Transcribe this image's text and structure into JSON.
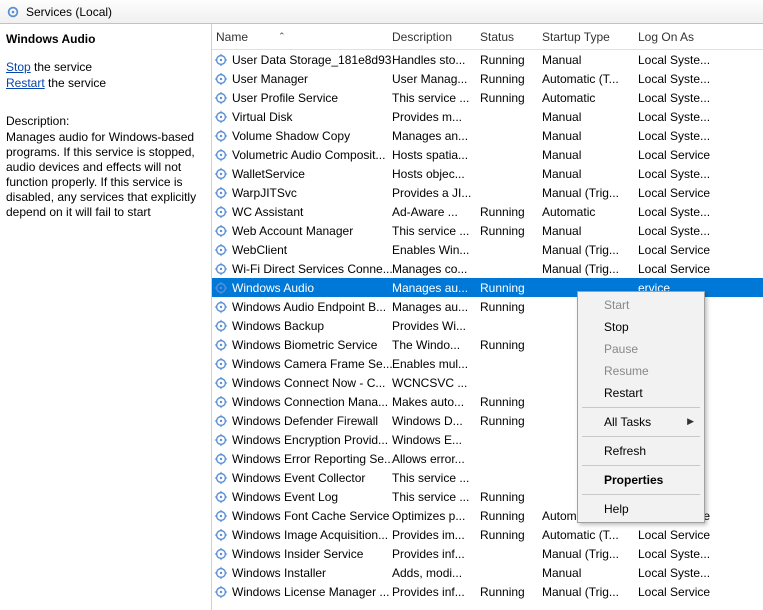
{
  "titlebar": {
    "label": "Services (Local)"
  },
  "left": {
    "service_title": "Windows Audio",
    "stop_label": "Stop",
    "stop_suffix": " the service",
    "restart_label": "Restart",
    "restart_suffix": " the service",
    "desc_head": "Description:",
    "desc_body": "Manages audio for Windows-based programs.  If this service is stopped, audio devices and effects will not function properly. If this service is disabled, any services that explicitly depend on it will fail to start"
  },
  "columns": {
    "name": "Name",
    "desc": "Description",
    "status": "Status",
    "startup": "Startup Type",
    "logon": "Log On As"
  },
  "rows": [
    {
      "name": "User Data Storage_181e8d93",
      "desc": "Handles sto...",
      "status": "Running",
      "startup": "Manual",
      "logon": "Local Syste..."
    },
    {
      "name": "User Manager",
      "desc": "User Manag...",
      "status": "Running",
      "startup": "Automatic (T...",
      "logon": "Local Syste..."
    },
    {
      "name": "User Profile Service",
      "desc": "This service ...",
      "status": "Running",
      "startup": "Automatic",
      "logon": "Local Syste..."
    },
    {
      "name": "Virtual Disk",
      "desc": "Provides m...",
      "status": "",
      "startup": "Manual",
      "logon": "Local Syste..."
    },
    {
      "name": "Volume Shadow Copy",
      "desc": "Manages an...",
      "status": "",
      "startup": "Manual",
      "logon": "Local Syste..."
    },
    {
      "name": "Volumetric Audio Composit...",
      "desc": "Hosts spatia...",
      "status": "",
      "startup": "Manual",
      "logon": "Local Service"
    },
    {
      "name": "WalletService",
      "desc": "Hosts objec...",
      "status": "",
      "startup": "Manual",
      "logon": "Local Syste..."
    },
    {
      "name": "WarpJITSvc",
      "desc": "Provides a JI...",
      "status": "",
      "startup": "Manual (Trig...",
      "logon": "Local Service"
    },
    {
      "name": "WC Assistant",
      "desc": "Ad-Aware ...",
      "status": "Running",
      "startup": "Automatic",
      "logon": "Local Syste..."
    },
    {
      "name": "Web Account Manager",
      "desc": "This service ...",
      "status": "Running",
      "startup": "Manual",
      "logon": "Local Syste..."
    },
    {
      "name": "WebClient",
      "desc": "Enables Win...",
      "status": "",
      "startup": "Manual (Trig...",
      "logon": "Local Service"
    },
    {
      "name": "Wi-Fi Direct Services Conne...",
      "desc": "Manages co...",
      "status": "",
      "startup": "Manual (Trig...",
      "logon": "Local Service"
    },
    {
      "name": "Windows Audio",
      "desc": "Manages au...",
      "status": "Running",
      "startup": "",
      "logon": "ervice",
      "selected": true
    },
    {
      "name": "Windows Audio Endpoint B...",
      "desc": "Manages au...",
      "status": "Running",
      "startup": "",
      "logon": "ste..."
    },
    {
      "name": "Windows Backup",
      "desc": "Provides Wi...",
      "status": "",
      "startup": "",
      "logon": "ste..."
    },
    {
      "name": "Windows Biometric Service",
      "desc": "The Windo...",
      "status": "Running",
      "startup": "",
      "logon": "ste..."
    },
    {
      "name": "Windows Camera Frame Se...",
      "desc": "Enables mul...",
      "status": "",
      "startup": "",
      "logon": "ervice"
    },
    {
      "name": "Windows Connect Now - C...",
      "desc": "WCNCSVC ...",
      "status": "",
      "startup": "",
      "logon": "ervice"
    },
    {
      "name": "Windows Connection Mana...",
      "desc": "Makes auto...",
      "status": "Running",
      "startup": "",
      "logon": "ste..."
    },
    {
      "name": "Windows Defender Firewall",
      "desc": "Windows D...",
      "status": "Running",
      "startup": "",
      "logon": "ervice"
    },
    {
      "name": "Windows Encryption Provid...",
      "desc": "Windows E...",
      "status": "",
      "startup": "",
      "logon": "ervice"
    },
    {
      "name": "Windows Error Reporting Se...",
      "desc": "Allows error...",
      "status": "",
      "startup": "",
      "logon": "ste..."
    },
    {
      "name": "Windows Event Collector",
      "desc": "This service ...",
      "status": "",
      "startup": "",
      "logon": "k S..."
    },
    {
      "name": "Windows Event Log",
      "desc": "This service ...",
      "status": "Running",
      "startup": "",
      "logon": "ervice"
    },
    {
      "name": "Windows Font Cache Service",
      "desc": "Optimizes p...",
      "status": "Running",
      "startup": "Automatic",
      "logon": "Local Service"
    },
    {
      "name": "Windows Image Acquisition...",
      "desc": "Provides im...",
      "status": "Running",
      "startup": "Automatic (T...",
      "logon": "Local Service"
    },
    {
      "name": "Windows Insider Service",
      "desc": "Provides inf...",
      "status": "",
      "startup": "Manual (Trig...",
      "logon": "Local Syste..."
    },
    {
      "name": "Windows Installer",
      "desc": "Adds, modi...",
      "status": "",
      "startup": "Manual",
      "logon": "Local Syste..."
    },
    {
      "name": "Windows License Manager ...",
      "desc": "Provides inf...",
      "status": "Running",
      "startup": "Manual (Trig...",
      "logon": "Local Service"
    }
  ],
  "menu": {
    "start": "Start",
    "stop": "Stop",
    "pause": "Pause",
    "resume": "Resume",
    "restart": "Restart",
    "alltasks": "All Tasks",
    "refresh": "Refresh",
    "properties": "Properties",
    "help": "Help"
  }
}
